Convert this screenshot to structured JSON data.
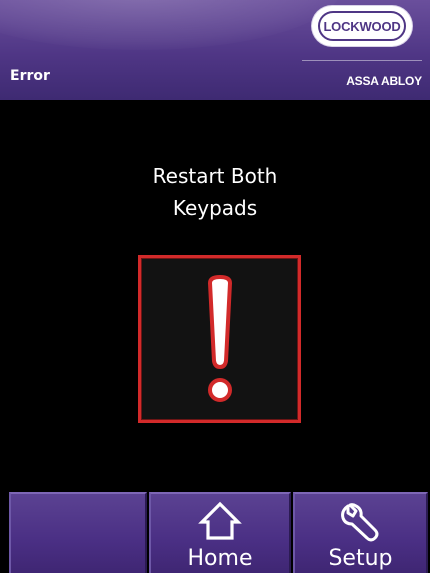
{
  "header": {
    "title": "Error",
    "brand": "LOCKWOOD",
    "brand_sub": "ASSA ABLOY"
  },
  "main": {
    "message_line1": "Restart Both",
    "message_line2": "Keypads",
    "alert_icon": "exclamation-icon"
  },
  "nav": {
    "buttons": [
      {
        "label": "",
        "icon": null
      },
      {
        "label": "Home",
        "icon": "home-icon"
      },
      {
        "label": "Setup",
        "icon": "wrench-icon"
      }
    ]
  },
  "colors": {
    "header_purple": "#4f3685",
    "alert_red": "#d22a2a",
    "background": "#000000",
    "text": "#ffffff"
  }
}
